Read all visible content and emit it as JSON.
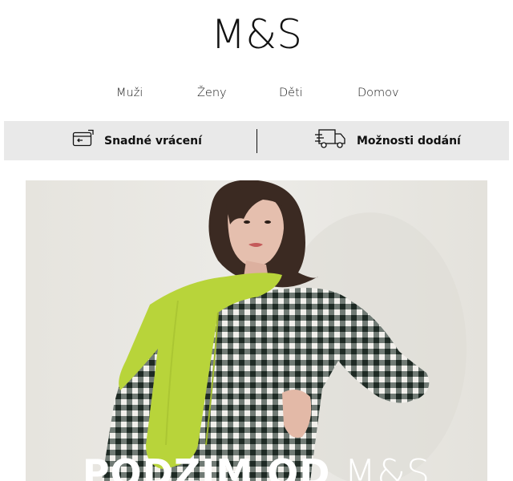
{
  "brand": {
    "logo_text": "M&S"
  },
  "nav": {
    "items": [
      {
        "label": "Muži"
      },
      {
        "label": "Ženy"
      },
      {
        "label": "Děti"
      },
      {
        "label": "Domov"
      }
    ]
  },
  "services": {
    "returns": {
      "label": "Snadné vrácení",
      "icon": "return-card-icon"
    },
    "delivery": {
      "label": "Možnosti dodání",
      "icon": "delivery-truck-icon"
    }
  },
  "hero": {
    "headline_bold": "PODZIM OD ",
    "headline_light": "M&S",
    "image_description_icon": "model-photo",
    "colors": {
      "scarf": "#b8d43a",
      "dress_dark": "#1e2a24",
      "background": "#e8e6e0",
      "hair": "#3b2a22"
    }
  }
}
